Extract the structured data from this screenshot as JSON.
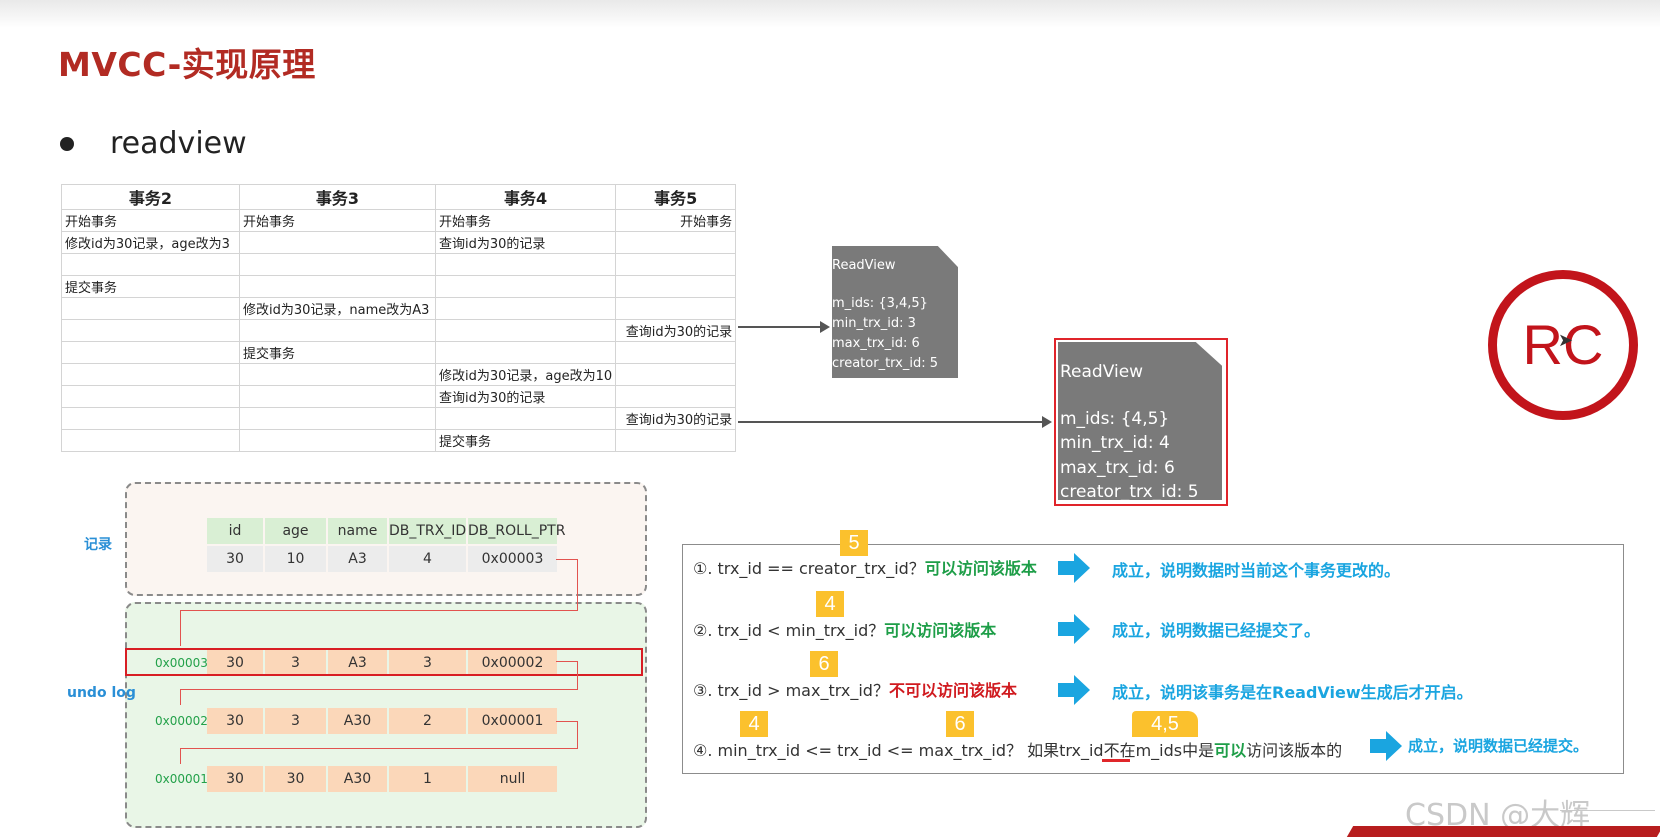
{
  "slide": {
    "title": "MVCC-实现原理",
    "bullet": "readview"
  },
  "tx_table": {
    "headers": [
      "事务2",
      "事务3",
      "事务4",
      "事务5"
    ],
    "rows": [
      [
        "开始事务",
        "开始事务",
        "开始事务",
        "开始事务"
      ],
      [
        "修改id为30记录，age改为3",
        "",
        "查询id为30的记录",
        ""
      ],
      [
        "",
        "",
        "",
        ""
      ],
      [
        "提交事务",
        "",
        "",
        ""
      ],
      [
        "",
        "修改id为30记录，name改为A3",
        "",
        ""
      ],
      [
        "",
        "",
        "",
        "查询id为30的记录"
      ],
      [
        "",
        "提交事务",
        "",
        ""
      ],
      [
        "",
        "",
        "修改id为30记录，age改为10",
        ""
      ],
      [
        "",
        "",
        "查询id为30的记录",
        ""
      ],
      [
        "",
        "",
        "",
        "查询id为30的记录"
      ],
      [
        "",
        "",
        "提交事务",
        ""
      ]
    ]
  },
  "readview1": {
    "heading": "ReadView",
    "m_ids": "m_ids: {3,4,5}",
    "min_trx_id": "min_trx_id: 3",
    "max_trx_id": "max_trx_id: 6",
    "creator_trx_id": "creator_trx_id: 5"
  },
  "readview2": {
    "heading": "ReadView",
    "m_ids": "m_ids: {4,5}",
    "min_trx_id": "min_trx_id: 4",
    "max_trx_id": "max_trx_id: 6",
    "creator_trx_id": "creator_trx_id: 5"
  },
  "rc_badge": "RC",
  "record": {
    "label": "记录",
    "columns": [
      "id",
      "age",
      "name",
      "DB_TRX_ID",
      "DB_ROLL_PTR"
    ],
    "values": [
      "30",
      "10",
      "A3",
      "4",
      "0x00003"
    ]
  },
  "undo_log": {
    "label": "undo log",
    "rows": [
      {
        "addr": "0x00003",
        "values": [
          "30",
          "3",
          "A3",
          "3",
          "0x00002"
        ]
      },
      {
        "addr": "0x00002",
        "values": [
          "30",
          "3",
          "A30",
          "2",
          "0x00001"
        ]
      },
      {
        "addr": "0x00001",
        "values": [
          "30",
          "30",
          "A30",
          "1",
          "null"
        ]
      }
    ]
  },
  "rules": {
    "r1": {
      "cond": "①. trx_id  == creator_trx_id？",
      "verdict": "可以访问该版本",
      "badge": "5",
      "result": "成立，说明数据时当前这个事务更改的。"
    },
    "r2": {
      "cond": "②. trx_id < min_trx_id？",
      "verdict": "可以访问该版本",
      "badge": "4",
      "result": "成立，说明数据已经提交了。"
    },
    "r3": {
      "cond": "③. trx_id > max_trx_id？",
      "verdict": "不可以访问该版本",
      "badge": "6",
      "result": "成立，说明该事务是在ReadView生成后才开启。"
    },
    "r4": {
      "part1": "④. min_trx_id <= trx_id <= max_trx_id？ 如果trx_id",
      "part2": "不在",
      "part3": "m_ids中是",
      "part4": "可以",
      "part5": "访问该版本的",
      "badge_a": "4",
      "badge_b": "6",
      "badge_c": "4,5",
      "result": "成立，说明数据已经提交。"
    }
  },
  "watermark": "CSDN @大辉",
  "colors": {
    "title": "#b22b23",
    "accent_green": "#1e9e48",
    "accent_red": "#d01a1f",
    "accent_blue": "#1aa5e0",
    "badge": "#fbc12d"
  }
}
